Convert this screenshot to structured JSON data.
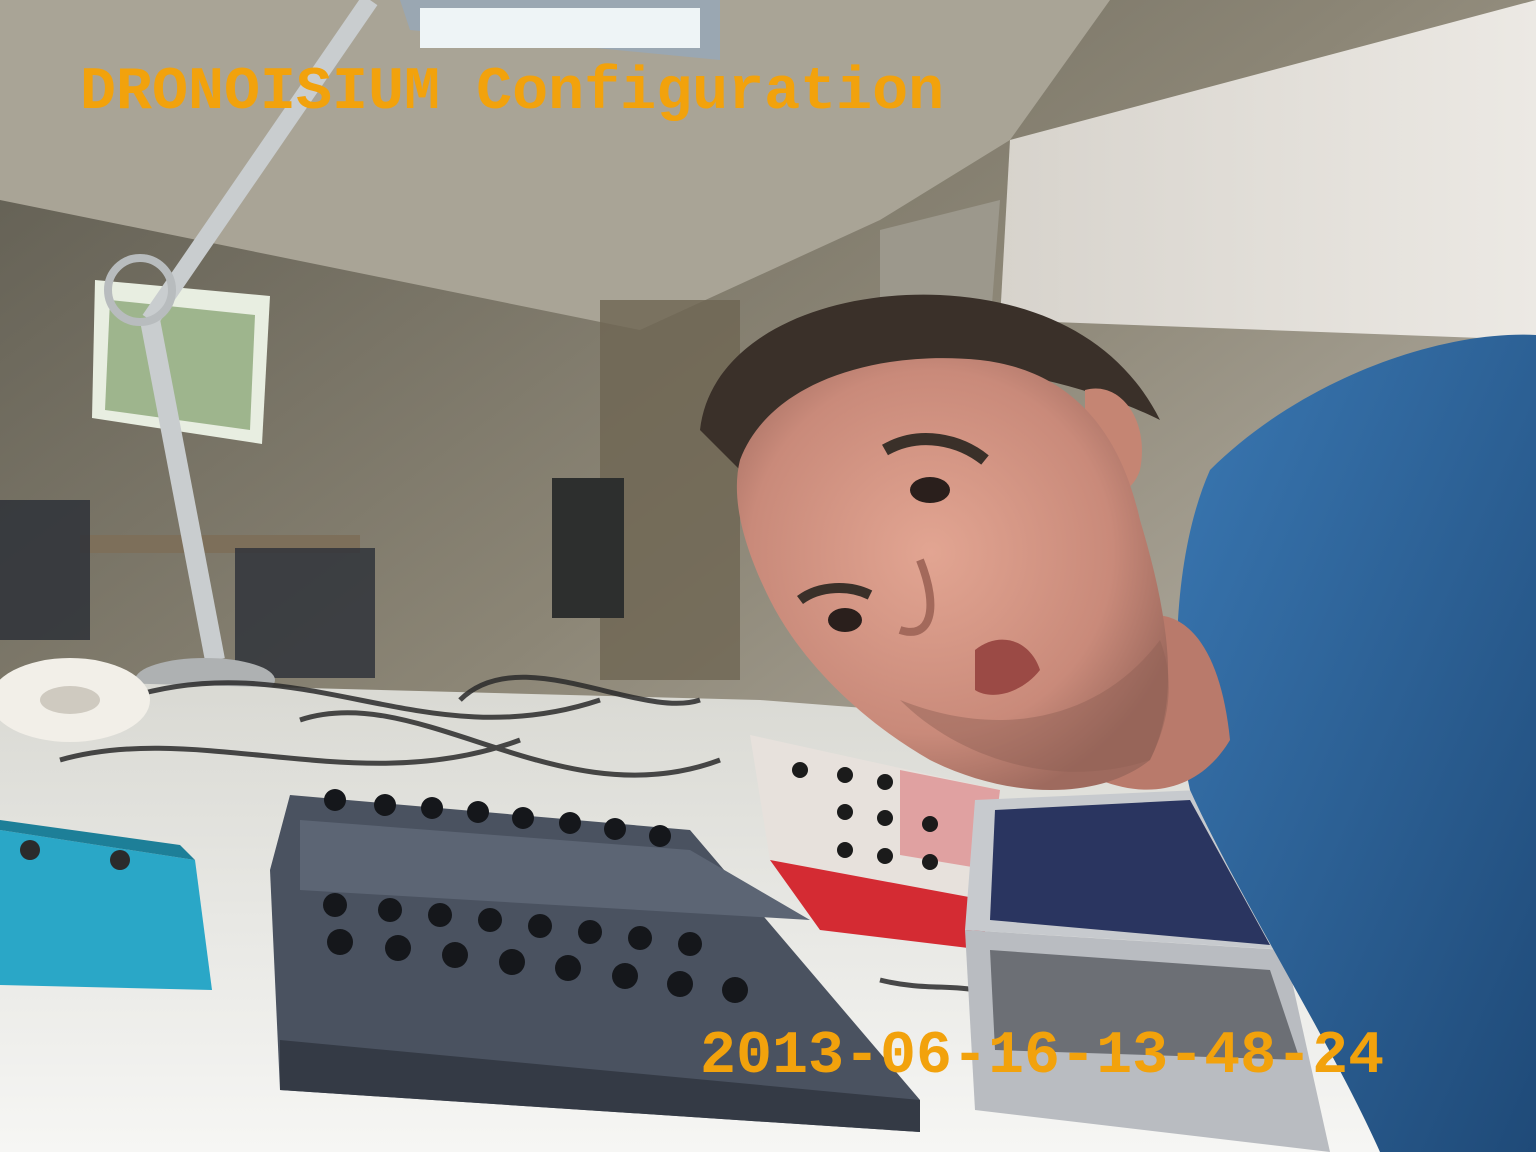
{
  "overlay": {
    "title": "DRONOISIUM Configuration",
    "timestamp": "2013-06-16-13-48-24"
  },
  "colors": {
    "overlay_text": "#f2a20c",
    "wall": "#bfb9ad",
    "ceiling": "#d9d4cb",
    "table": "#e9e9e6",
    "shirt": "#2c5f93",
    "skin": "#c98a7a",
    "hair": "#3a3029",
    "controller": "#4a5260",
    "synth": "#d42b33",
    "pedal": "#2aa7c7",
    "laptop": "#b9bcc1"
  },
  "icons": {
    "lamp": "desk-lamp-icon",
    "controller": "knob-controller-icon",
    "synth": "red-synth-icon",
    "pedal": "effects-pedal-icon",
    "laptop": "laptop-icon"
  }
}
